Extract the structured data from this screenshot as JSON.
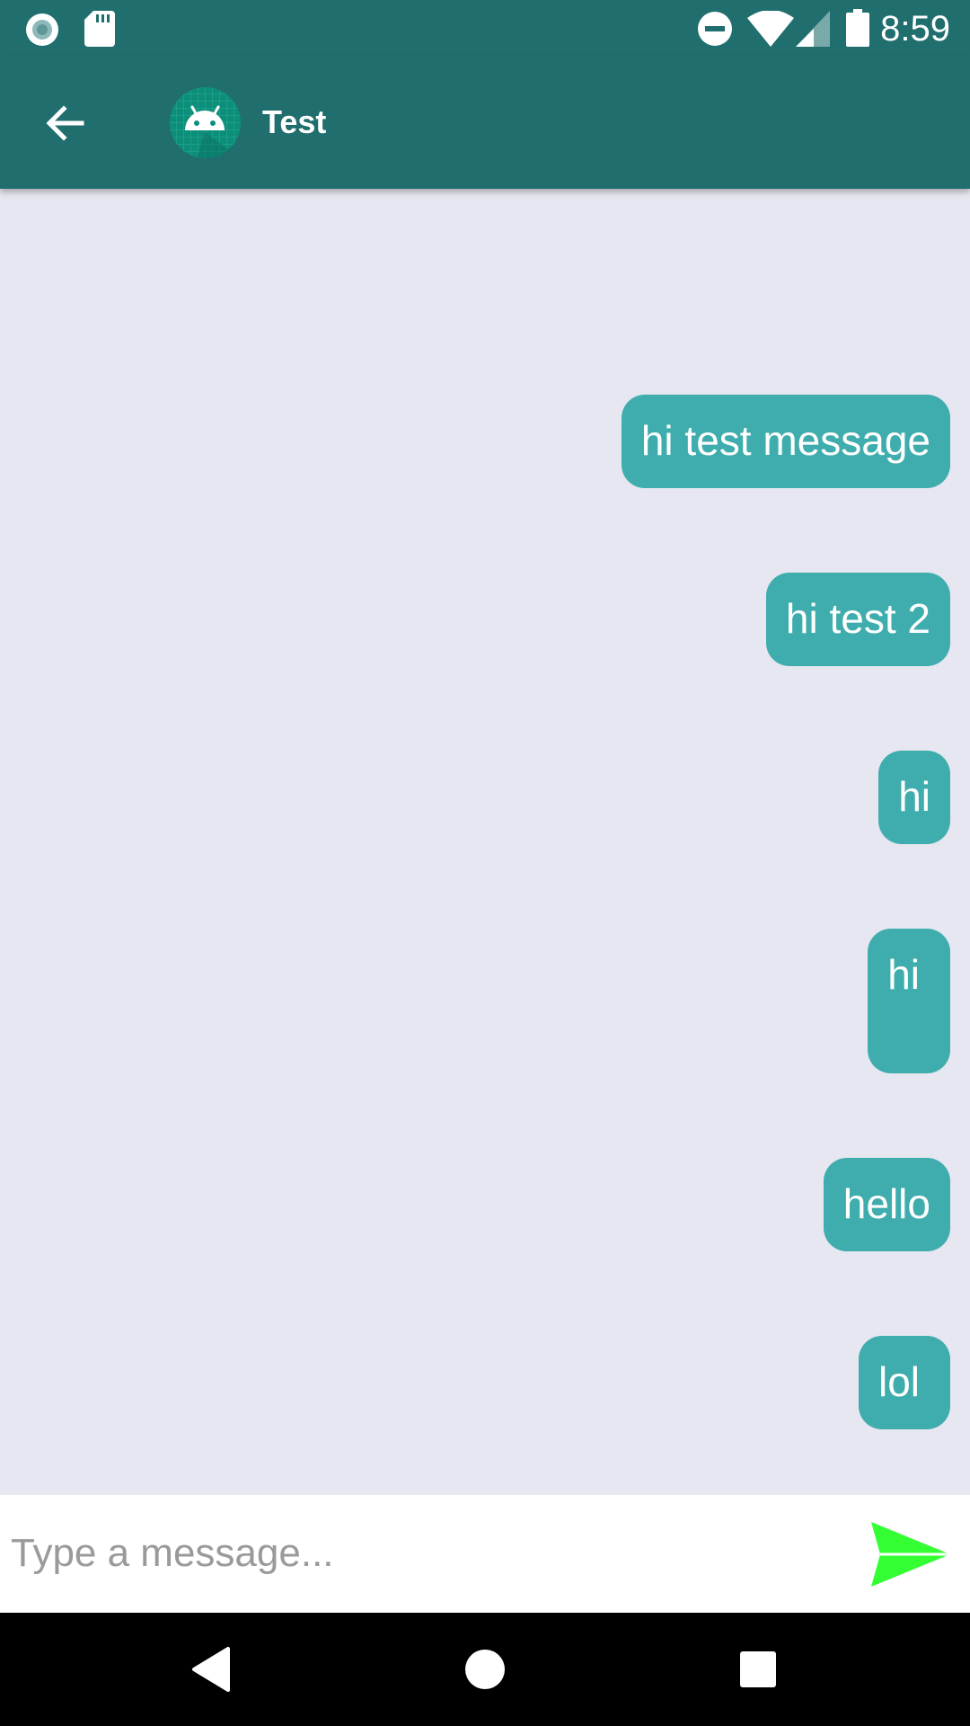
{
  "status_bar": {
    "time": "8:59",
    "icons": [
      "record-icon",
      "sd-card-icon",
      "do-not-disturb-icon",
      "wifi-icon",
      "cell-signal-icon",
      "battery-icon"
    ]
  },
  "app_bar": {
    "title": "Test",
    "back_icon": "arrow-back-icon",
    "avatar_icon": "android-icon"
  },
  "messages": [
    {
      "text": "hi test message",
      "sender": "me"
    },
    {
      "text": "hi test 2",
      "sender": "me"
    },
    {
      "text": "hi",
      "sender": "me"
    },
    {
      "text": "hi",
      "sender": "me"
    },
    {
      "text": "hello",
      "sender": "me"
    },
    {
      "text": "lol",
      "sender": "me"
    }
  ],
  "composer": {
    "placeholder": "Type a message...",
    "value": "",
    "send_icon": "send-icon"
  },
  "nav_bar": {
    "icons": [
      "nav-back-icon",
      "nav-home-icon",
      "nav-recents-icon"
    ]
  },
  "colors": {
    "primary": "#206e6e",
    "bubble": "#3fadad",
    "background": "#e6e7f0",
    "send": "#33ff33"
  }
}
